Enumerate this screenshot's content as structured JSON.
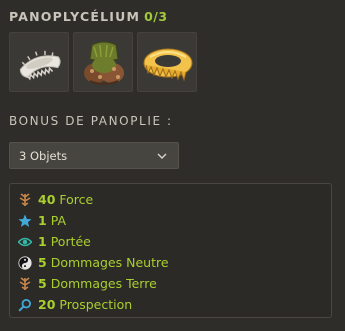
{
  "set": {
    "name": "PANOPLYCÉLIUM",
    "count": "0/3",
    "items": [
      {
        "icon": "white-fur-collar-icon"
      },
      {
        "icon": "mushroom-cloak-icon"
      },
      {
        "icon": "straw-ring-belt-icon"
      }
    ]
  },
  "bonus": {
    "title": "BONUS DE PANOPLIE :",
    "selected": "3 Objets",
    "effects": [
      {
        "value": "40",
        "label": "Force",
        "icon": "strength-icon",
        "color": "#c9874a"
      },
      {
        "value": "1",
        "label": "PA",
        "icon": "star-icon",
        "color": "#41a9d9"
      },
      {
        "value": "1",
        "label": "Portée",
        "icon": "eye-icon",
        "color": "#33b7a6"
      },
      {
        "value": "5",
        "label": "Dommages Neutre",
        "icon": "yin-yang-icon",
        "color": "#e5e5e5"
      },
      {
        "value": "5",
        "label": "Dommages Terre",
        "icon": "earth-icon",
        "color": "#c9874a"
      },
      {
        "value": "20",
        "label": "Prospection",
        "icon": "magnifier-icon",
        "color": "#41a9d9"
      }
    ]
  }
}
